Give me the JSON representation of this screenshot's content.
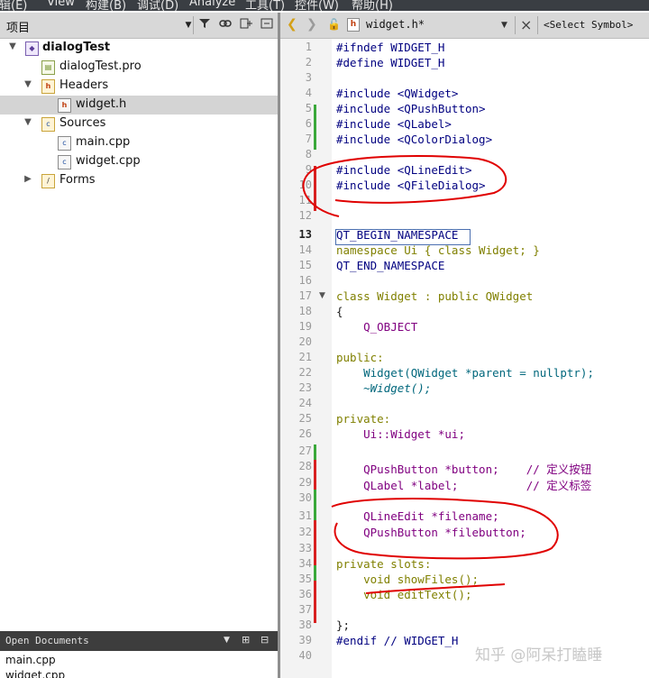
{
  "menubar": {
    "items": [
      "编辑(E)",
      "View",
      "构建(B)",
      "调试(D)",
      "Analyze",
      "工具(T)",
      "控件(W)",
      "帮助(H)"
    ]
  },
  "project_panel": {
    "title": "项目",
    "tree": [
      {
        "label": "dialogTest",
        "level": 0,
        "expanded": true,
        "bold": true,
        "icon": "project-icon"
      },
      {
        "label": "dialogTest.pro",
        "level": 1,
        "icon": "pro-file-icon"
      },
      {
        "label": "Headers",
        "level": 1,
        "expanded": true,
        "icon": "headers-folder-icon"
      },
      {
        "label": "widget.h",
        "level": 2,
        "selected": true,
        "icon": "header-file-icon"
      },
      {
        "label": "Sources",
        "level": 1,
        "expanded": true,
        "icon": "sources-folder-icon"
      },
      {
        "label": "main.cpp",
        "level": 2,
        "icon": "cpp-file-icon"
      },
      {
        "label": "widget.cpp",
        "level": 2,
        "icon": "cpp-file-icon"
      },
      {
        "label": "Forms",
        "level": 1,
        "expanded": false,
        "icon": "forms-folder-icon"
      }
    ]
  },
  "open_documents": {
    "title": "Open Documents",
    "items": [
      "main.cpp",
      "widget.cpp"
    ]
  },
  "editor": {
    "file_tab": "widget.h*",
    "symbol_selector": "<Select Symbol>",
    "current_line": 13,
    "line_numbers": [
      "1",
      "2",
      "3",
      "4",
      "5",
      "6",
      "7",
      "8",
      "9",
      "10",
      "11",
      "12",
      "13",
      "14",
      "15",
      "16",
      "17",
      "18",
      "19",
      "20",
      "21",
      "22",
      "23",
      "24",
      "25",
      "26",
      "27",
      "28",
      "29",
      "30",
      "31",
      "32",
      "33",
      "34",
      "35",
      "36",
      "37",
      "38",
      "39",
      "40"
    ],
    "lines": [
      "#ifndef WIDGET_H",
      "#define WIDGET_H",
      "",
      "#include <QWidget>",
      "#include <QPushButton>",
      "#include <QLabel>",
      "#include <QColorDialog>",
      "",
      "#include <QLineEdit>",
      "#include <QFileDialog>",
      "",
      "",
      "QT_BEGIN_NAMESPACE",
      "namespace Ui { class Widget; }",
      "QT_END_NAMESPACE",
      "",
      "class Widget : public QWidget",
      "{",
      "    Q_OBJECT",
      "",
      "public:",
      "    Widget(QWidget *parent = nullptr);",
      "    ~Widget();",
      "",
      "private:",
      "    Ui::Widget *ui;",
      "",
      "    QPushButton *button;    // 定义按钮",
      "    QLabel *label;          // 定义标签",
      "",
      "    QLineEdit *filename;",
      "    QPushButton *filebutton;",
      "",
      "private slots:",
      "    void showFiles();",
      "    void editText();",
      "",
      "};",
      "#endif // WIDGET_H",
      ""
    ]
  },
  "watermark": "知乎 @阿呆打瞌睡",
  "colors": {
    "keyword": "#808000",
    "preprocessor": "#000080",
    "include_path": "#008000",
    "class_type": "#800080",
    "function": "#00677c",
    "annotation_ink": "#e00000",
    "change_mark_green": "#3aa83a",
    "change_mark_red": "#d82020"
  }
}
